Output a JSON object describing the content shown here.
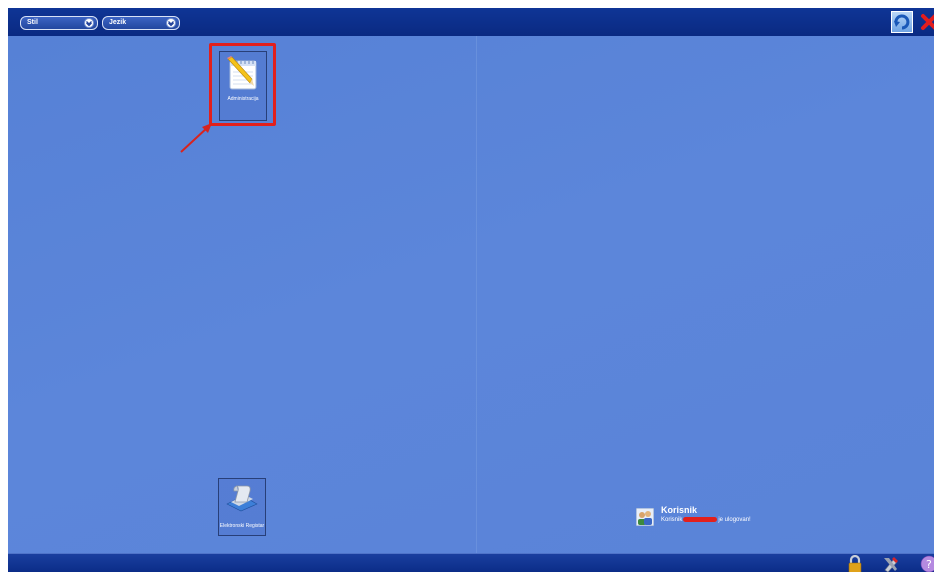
{
  "toolbar": {
    "style_dropdown": "Stil",
    "language_dropdown": "Jezik"
  },
  "desktop": {
    "icons": [
      {
        "label": "Administracija",
        "icon": "notepad-pencil-icon"
      },
      {
        "label": "Elektronski Registar",
        "icon": "document-stack-icon"
      }
    ]
  },
  "user_panel": {
    "title": "Korisnik",
    "message_prefix": "Korisnik",
    "message_suffix": "je ulogovan!"
  },
  "colors": {
    "bar": "#0f3596",
    "desktop": "#5a84d8",
    "highlight": "#e2201c"
  }
}
